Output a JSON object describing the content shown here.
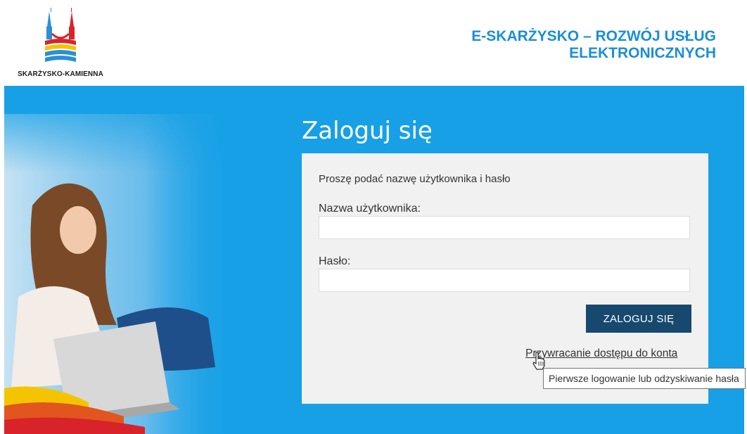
{
  "header": {
    "logo_text": "SKARŻYSKO-KAMIENNA",
    "title_line1": "E-SKARŻYSKO – ROZWÓJ USŁUG",
    "title_line2": "ELEKTRONICZNYCH",
    "brand_color": "#1b8ed6"
  },
  "login": {
    "title": "Zaloguj się",
    "instruction": "Proszę podać nazwę użytkownika i hasło",
    "username_label": "Nazwa użytkownika:",
    "username_value": "",
    "password_label": "Hasło:",
    "password_value": "",
    "submit_label": "ZALOGUJ SIĘ",
    "recover_link": "Przywracanie dostępu do konta",
    "tooltip": "Pierwsze logowanie lub odzyskiwanie hasła"
  },
  "colors": {
    "hero_bg": "#17a0e6",
    "button_bg": "#17486e",
    "panel_bg": "#f1f1f1"
  },
  "icons": {
    "logo": "skarzysko-kamienna-crest",
    "cursor": "hand-pointer-icon"
  }
}
